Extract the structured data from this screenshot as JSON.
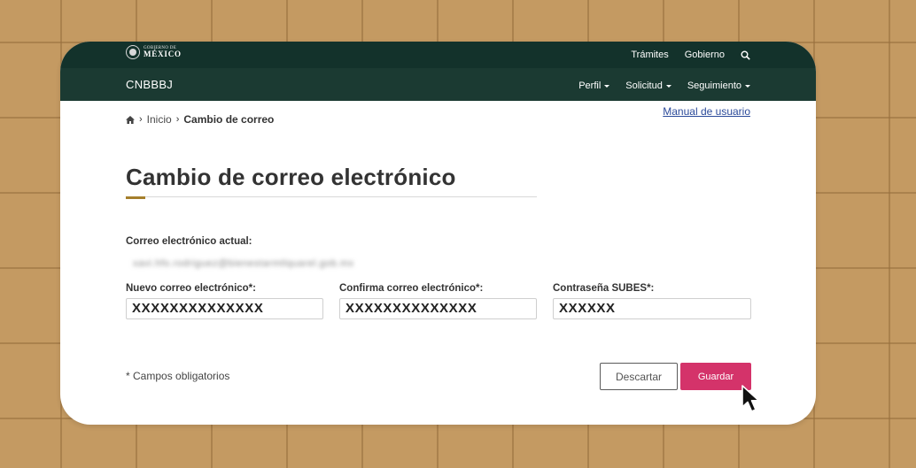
{
  "header": {
    "logo": {
      "line1": "GOBIERNO DE",
      "line2": "MÉXICO"
    },
    "top_links": [
      "Trámites",
      "Gobierno"
    ],
    "search_icon": "search-icon"
  },
  "navbar": {
    "brand": "CNBBBJ",
    "menu": [
      {
        "label": "Perfil"
      },
      {
        "label": "Solicitud"
      },
      {
        "label": "Seguimiento"
      }
    ]
  },
  "breadcrumb": {
    "home_icon": "home-icon",
    "items": [
      "Inicio",
      "Cambio de correo"
    ]
  },
  "manual_link": "Manual de usuario",
  "page_title": "Cambio de correo electrónico",
  "form": {
    "current_email_label": "Correo electrónico actual:",
    "current_email_value": "xavi.hfo.rodriguez@bienestarmtlquarel.gob.mx",
    "new_email_label": "Nuevo correo electrónico*:",
    "new_email_value": "XXXXXXXXXXXXXX",
    "confirm_email_label": "Confirma correo electrónico*:",
    "confirm_email_value": "XXXXXXXXXXXXXX",
    "password_label": "Contraseña SUBES*:",
    "password_value": "XXXXXX",
    "required_note": "* Campos obligatorios",
    "discard_label": "Descartar",
    "save_label": "Guardar"
  },
  "colors": {
    "header_dark": "#13322b",
    "navbar": "#1b3a32",
    "accent_gold": "#a57f2c",
    "save_button": "#d4336a",
    "background": "#c49a62"
  }
}
